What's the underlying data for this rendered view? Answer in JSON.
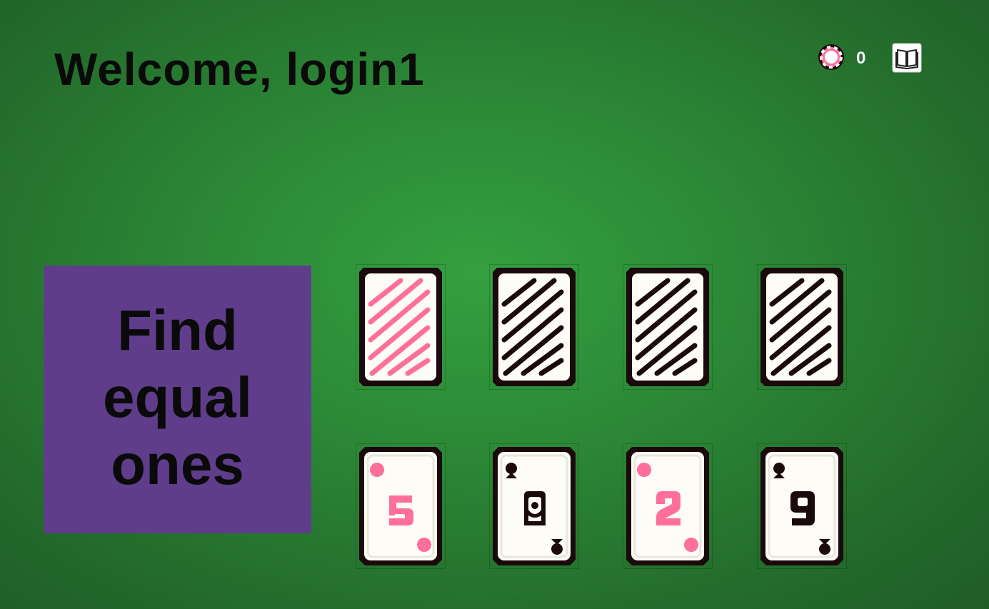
{
  "header": {
    "welcome_text": "Welcome, login1",
    "coins": "0",
    "chip_icon": "poker-chip-icon",
    "rules_icon": "book-icon"
  },
  "task": {
    "text": "Find equal ones"
  },
  "colors": {
    "background": "#2c8a37",
    "panel": "#5f3d8b",
    "pink": "#ff6f9b",
    "ink": "#1a0a0c",
    "card_face": "#fefcf7"
  },
  "top_row_cards": [
    {
      "state": "face-down",
      "back_color": "pink"
    },
    {
      "state": "face-down",
      "back_color": "black"
    },
    {
      "state": "face-down",
      "back_color": "black"
    },
    {
      "state": "face-down",
      "back_color": "black"
    }
  ],
  "bottom_row_cards": [
    {
      "state": "face-up",
      "rank": "5",
      "suit": "diamonds",
      "color": "pink"
    },
    {
      "state": "face-up",
      "rank": "A",
      "suit": "spades",
      "color": "black"
    },
    {
      "state": "face-up",
      "rank": "2",
      "suit": "diamonds",
      "color": "pink"
    },
    {
      "state": "face-up",
      "rank": "9",
      "suit": "spades",
      "color": "black"
    }
  ]
}
